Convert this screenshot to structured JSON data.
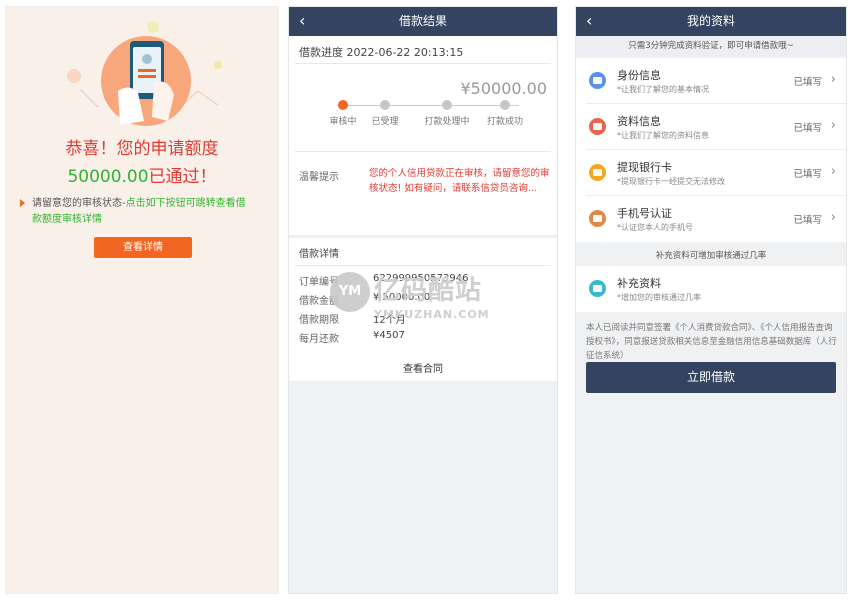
{
  "panel1": {
    "title_line1": "恭喜！您的申请额度",
    "amount": "50000.00",
    "passed": "已通过！",
    "note_prefix": "请留意您的审核状态-",
    "note_green": "点击如下按钮可跳转查看借款额度审核详情",
    "button": "查看详情"
  },
  "panel2": {
    "nav_title": "借款结果",
    "progress_label": "借款进度",
    "progress_time": "2022-06-22 20:13:15",
    "big_amount": "¥50000.00",
    "steps": [
      "审核中",
      "已受理",
      "打款处理中",
      "打款成功"
    ],
    "tip_label": "温馨提示",
    "tip_text": "您的个人信用贷款正在审核，请留意您的审核状态! 如有疑问，请联系信贷员咨询...",
    "detail_header": "借款详情",
    "rows": [
      {
        "label": "订单编号",
        "value": "622999950573946"
      },
      {
        "label": "借款金额",
        "value": "¥ 50000.00"
      },
      {
        "label": "借款期限",
        "value": "12个月"
      },
      {
        "label": "每月还款",
        "value": "¥4507"
      }
    ],
    "contract": "查看合同"
  },
  "watermark": {
    "big": "亿码酷站",
    "small": "YMKUZHAN.COM",
    "logo": "YM"
  },
  "panel3": {
    "nav_title": "我的资料",
    "subtitle": "只需3分钟完成资料验证，即可申请借款哦~",
    "items": [
      {
        "name": "身份信息",
        "desc": "*让我们了解您的基本情况",
        "status": "已填写",
        "color": "#5b8fe8",
        "icon": "id-card-icon"
      },
      {
        "name": "资料信息",
        "desc": "*让我们了解您的资料信息",
        "status": "已填写",
        "color": "#e8644f",
        "icon": "profile-card-icon"
      },
      {
        "name": "提现银行卡",
        "desc": "*提现银行卡一经提交无法修改",
        "status": "已填写",
        "color": "#f5a623",
        "icon": "bank-card-icon"
      },
      {
        "name": "手机号认证",
        "desc": "*认证您本人的手机号",
        "status": "已填写",
        "color": "#e0874a",
        "icon": "phone-icon"
      }
    ],
    "supplement_hint": "补充资料可增加审核通过几率",
    "supplement": {
      "name": "补充资料",
      "desc": "*增加您的审核通过几率",
      "color": "#3cb8c9",
      "icon": "camera-icon"
    },
    "agreement": "本人已阅读并同意签署《个人消费贷款合同》、《个人信用报告查询授权书》，同意报送贷款相关信息至金融信用信息基础数据库（人行征信系统）",
    "button": "立即借款"
  }
}
